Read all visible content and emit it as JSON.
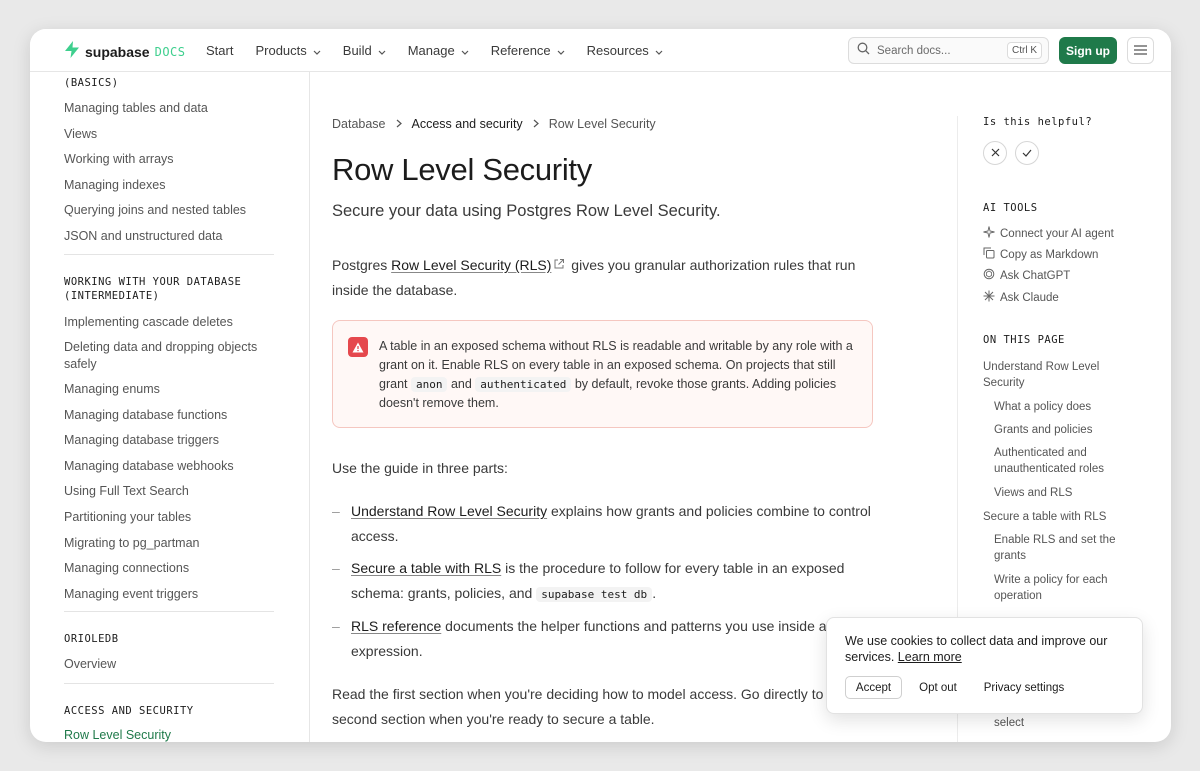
{
  "header": {
    "logo_word": "supabase",
    "logo_docs": "DOCS",
    "nav": [
      {
        "label": "Start",
        "dropdown": false
      },
      {
        "label": "Products",
        "dropdown": true
      },
      {
        "label": "Build",
        "dropdown": true
      },
      {
        "label": "Manage",
        "dropdown": true
      },
      {
        "label": "Reference",
        "dropdown": true
      },
      {
        "label": "Resources",
        "dropdown": true
      }
    ],
    "search_placeholder": "Search docs...",
    "search_shortcut": "Ctrl K",
    "signup_label": "Sign up"
  },
  "sidebar": {
    "section_basics_tail": "(BASICS)",
    "basics_items": [
      "Managing tables and data",
      "Views",
      "Working with arrays",
      "Managing indexes",
      "Querying joins and nested tables",
      "JSON and unstructured data"
    ],
    "section_intermediate": "WORKING WITH YOUR DATABASE (INTERMEDIATE)",
    "intermediate_items": [
      "Implementing cascade deletes",
      "Deleting data and dropping objects safely",
      "Managing enums",
      "Managing database functions",
      "Managing database triggers",
      "Managing database webhooks",
      "Using Full Text Search",
      "Partitioning your tables",
      "Migrating to pg_partman",
      "Managing connections",
      "Managing event triggers"
    ],
    "section_orioledb": "ORIOLEDB",
    "orioledb_items": [
      "Overview"
    ],
    "section_access": "ACCESS AND SECURITY",
    "access_items": [
      "Row Level Security"
    ]
  },
  "main": {
    "breadcrumbs": [
      "Database",
      "Access and security",
      "Row Level Security"
    ],
    "title": "Row Level Security",
    "subtitle": "Secure your data using Postgres Row Level Security.",
    "intro_prefix": "Postgres ",
    "intro_link": "Row Level Security (RLS)",
    "intro_suffix": " gives you granular authorization rules that run inside the database.",
    "callout": {
      "part1": "A table in an exposed schema without RLS is readable and writable by any role with a grant on it. Enable RLS on every table in an exposed schema. On projects that still grant ",
      "code1": "anon",
      "part2": " and ",
      "code2": "authenticated",
      "part3": " by default, revoke those grants. Adding policies doesn't remove them."
    },
    "guide_intro": "Use the guide in three parts:",
    "list": [
      {
        "link": "Understand Row Level Security",
        "text": " explains how grants and policies combine to control access."
      },
      {
        "link": "Secure a table with RLS",
        "text": " is the procedure to follow for every table in an exposed schema: grants, policies, and ",
        "code": "supabase test db",
        "tail": "."
      },
      {
        "link": "RLS reference",
        "text": " documents the helper functions and patterns you use inside a policy expression."
      }
    ],
    "closing": "Read the first section when you're deciding how to model access. Go directly to the second section when you're ready to secure a table."
  },
  "rail": {
    "helpful_label": "Is this helpful?",
    "ai_tools_label": "AI TOOLS",
    "ai_tools": [
      {
        "label": "Connect your AI agent",
        "icon": "sparkle-icon"
      },
      {
        "label": "Copy as Markdown",
        "icon": "copy-icon"
      },
      {
        "label": "Ask ChatGPT",
        "icon": "chatgpt-icon"
      },
      {
        "label": "Ask Claude",
        "icon": "claude-icon"
      }
    ],
    "on_this_page_label": "ON THIS PAGE",
    "toc": [
      {
        "label": "Understand Row Level Security",
        "level": 1
      },
      {
        "label": "What a policy does",
        "level": 2
      },
      {
        "label": "Grants and policies",
        "level": 2
      },
      {
        "label": "Authenticated and unauthenticated roles",
        "level": 2
      },
      {
        "label": "Views and RLS",
        "level": 2
      },
      {
        "label": "Secure a table with RLS",
        "level": 1
      },
      {
        "label": "Enable RLS and set the grants",
        "level": 2
      },
      {
        "label": "Write a policy for each operation",
        "level": 2
      },
      {
        "label": "select",
        "level": 2
      }
    ]
  },
  "cookie": {
    "text": "We use cookies to collect data and improve our services. ",
    "learn_more": "Learn more",
    "accept": "Accept",
    "opt_out": "Opt out",
    "privacy": "Privacy settings"
  },
  "colors": {
    "brand_green": "#3ecf8e",
    "button_green": "#1f7a4a",
    "danger": "#e5484d"
  }
}
